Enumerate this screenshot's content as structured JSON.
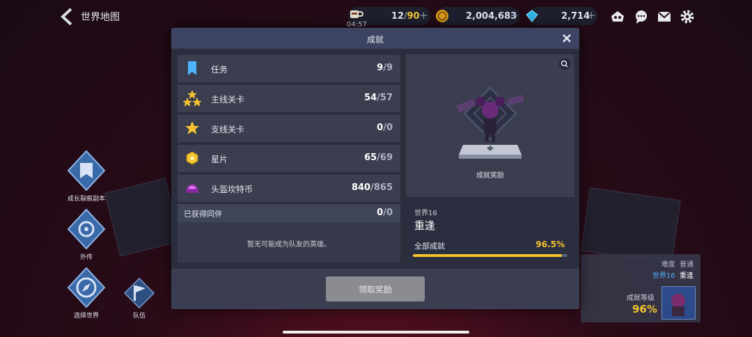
{
  "topbar": {
    "back_label": "世界地图",
    "stamina": {
      "current": "12",
      "max": "90",
      "timer": "04:57"
    },
    "gold": "2,004,683",
    "gems": "2,714",
    "plus": "+"
  },
  "sidebar": {
    "items": [
      {
        "label": "成长裂痕副本"
      },
      {
        "label": "外传"
      },
      {
        "label": "选择世界"
      },
      {
        "label": "队伍"
      }
    ]
  },
  "modal": {
    "title": "成就",
    "rows": [
      {
        "label": "任务",
        "value": "9",
        "total": "9",
        "icon": "bookmark-icon"
      },
      {
        "label": "主线关卡",
        "value": "54",
        "total": "57",
        "icon": "three-stars-icon"
      },
      {
        "label": "支线关卡",
        "value": "0",
        "total": "0",
        "icon": "star-icon"
      },
      {
        "label": "星片",
        "value": "65",
        "total": "69",
        "icon": "star-piece-icon"
      },
      {
        "label": "头盔坎特币",
        "value": "840",
        "total": "865",
        "icon": "helmet-coin-icon"
      }
    ],
    "companion": {
      "label": "已获得同伴",
      "value": "0",
      "total": "0",
      "empty_text": "暂无可能成为队友的英雄。"
    },
    "reward": {
      "label": "成就奖励",
      "world_number": "世界16",
      "world_name": "重逢",
      "overall_label": "全部成就",
      "overall_percent": "96.5%",
      "progress": 0.965
    },
    "claim_button": "领取奖励"
  },
  "info_card": {
    "difficulty_label": "难度",
    "difficulty_value": "普通",
    "world_number": "世界16",
    "world_name": "重逢",
    "rank_label": "成就等级",
    "rank_percent": "96%"
  },
  "colors": {
    "accent_gold": "#f4c430",
    "modal_header": "#3d4463",
    "world_blue": "#4fb5ff"
  }
}
